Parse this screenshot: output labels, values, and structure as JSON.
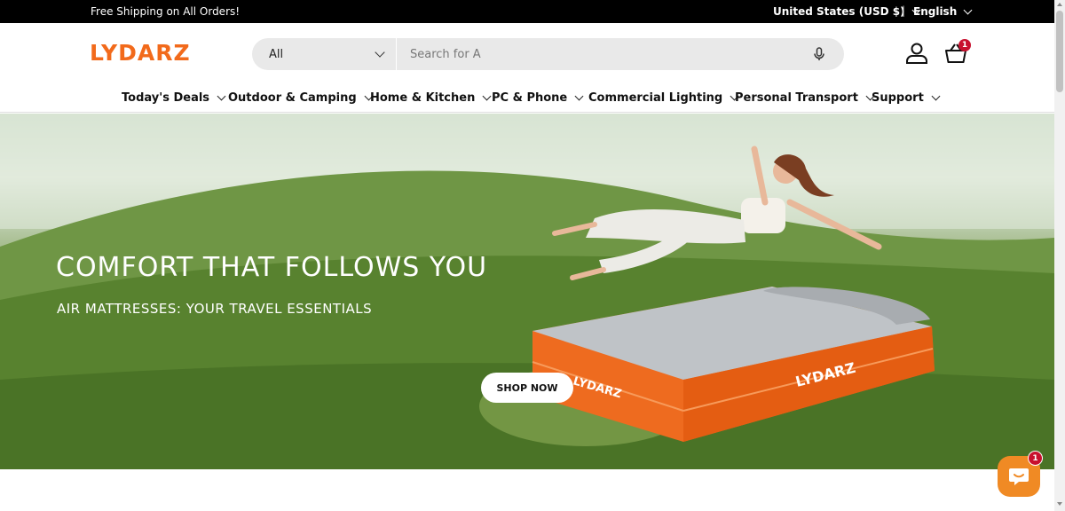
{
  "announcement": {
    "message": "Free Shipping on All Orders!",
    "region": "United States (USD $)",
    "separator": "|",
    "language": "English"
  },
  "header": {
    "logo": "LYDARZ",
    "search": {
      "category": "All",
      "placeholder": "Search for A"
    },
    "cart_count": "1"
  },
  "nav": {
    "items": [
      {
        "label": "Today's Deals"
      },
      {
        "label": "Outdoor & Camping"
      },
      {
        "label": "Home & Kitchen"
      },
      {
        "label": "PC & Phone"
      },
      {
        "label": "Commercial Lighting"
      },
      {
        "label": "Personal Transport"
      },
      {
        "label": "Support"
      }
    ]
  },
  "hero": {
    "headline": "COMFORT THAT FOLLOWS YOU",
    "subline": "AIR MATTRESSES: YOUR TRAVEL ESSENTIALS",
    "cta": "SHOP NOW",
    "mattress_brand": "LYDARZ"
  },
  "chat": {
    "badge": "1"
  },
  "colors": {
    "brand_orange": "#f26a1b",
    "badge_red": "#c8102e",
    "chat_orange": "#f08a24"
  }
}
